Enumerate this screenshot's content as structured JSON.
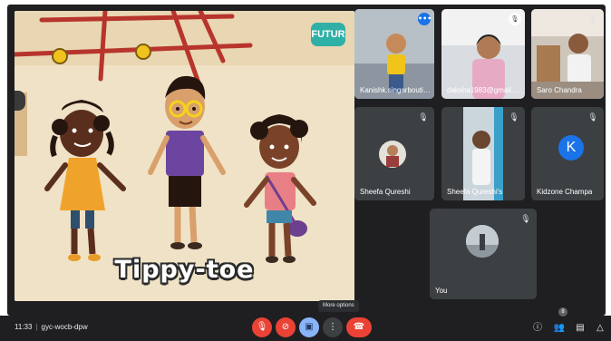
{
  "presentation": {
    "brand": "FUTUR",
    "caption": "Tippy-toe"
  },
  "tiles": [
    {
      "name": "Kanishk.singarbouti@...",
      "muted": false,
      "speaking": true
    },
    {
      "name": "daksha1983@gmail.c...",
      "muted": true
    },
    {
      "name": "Saro Chandra",
      "muted": true
    },
    {
      "name": "Sheefa Qureshi",
      "muted": true
    },
    {
      "name": "Sheefa Qureshi's",
      "muted": true
    },
    {
      "name": "Kidzone Champa",
      "muted": true,
      "initial": "K"
    },
    {
      "name": "You",
      "muted": true
    }
  ],
  "bottom_bar": {
    "time": "11:33",
    "meeting_code": "gyc-wocb-dpw",
    "tooltip": "More options",
    "people_count": "8"
  },
  "icons": {
    "mic_off": "mic-off-icon",
    "cam_off": "camera-off-icon",
    "present": "present-icon",
    "more": "more-vert-icon",
    "end_call": "end-call-icon",
    "info": "info-icon",
    "people": "people-icon",
    "chat": "chat-icon",
    "activities": "activities-icon"
  },
  "colors": {
    "end_call": "#ea4335",
    "active_tile": "#8ab4f8",
    "tile_bg": "#3c4043",
    "avatar_k": "#1a73e8"
  }
}
